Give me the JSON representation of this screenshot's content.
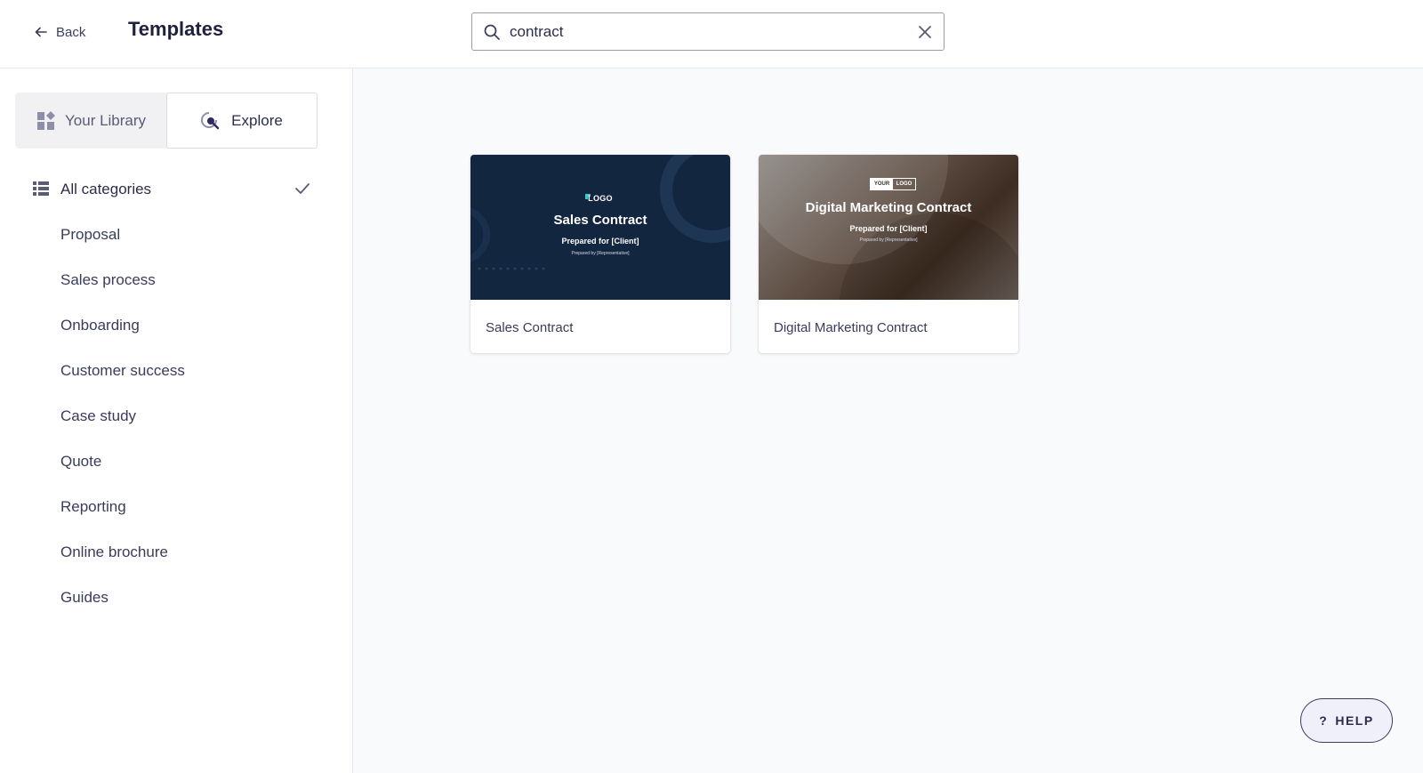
{
  "header": {
    "back_label": "Back",
    "title": "Templates",
    "search": {
      "value": "contract",
      "placeholder": ""
    }
  },
  "sidebar": {
    "toggle": {
      "library_label": "Your Library",
      "explore_label": "Explore",
      "active": "Explore"
    },
    "categories": [
      {
        "label": "All categories",
        "selected": true
      },
      {
        "label": "Proposal"
      },
      {
        "label": "Sales process"
      },
      {
        "label": "Onboarding"
      },
      {
        "label": "Customer success"
      },
      {
        "label": "Case study"
      },
      {
        "label": "Quote"
      },
      {
        "label": "Reporting"
      },
      {
        "label": "Online brochure"
      },
      {
        "label": "Guides"
      }
    ]
  },
  "results": [
    {
      "name": "Sales Contract",
      "thumb_logo": "LOGO",
      "thumb_title": "Sales Contract",
      "thumb_subtitle": "Prepared for [Client]",
      "thumb_small": "Prepared by [Representative]"
    },
    {
      "name": "Digital Marketing Contract",
      "thumb_logo_left": "YOUR",
      "thumb_logo_right": "LOGO",
      "thumb_title": "Digital Marketing Contract",
      "thumb_subtitle": "Prepared for [Client]",
      "thumb_small": "Prepared by [Representative]"
    }
  ],
  "help_label": "HELP",
  "icons": {
    "back": "arrow-left-icon",
    "search": "search-icon",
    "clear": "close-icon",
    "library": "grid-icon",
    "explore": "explore-icon",
    "categories": "list-icon",
    "check": "check-icon",
    "help": "question-icon"
  },
  "colors": {
    "accent": "#2b2d4a",
    "explore_icon": "#2f2a63",
    "sales_thumb_bg": "#13263f",
    "logo_accent": "#39c7d8"
  }
}
